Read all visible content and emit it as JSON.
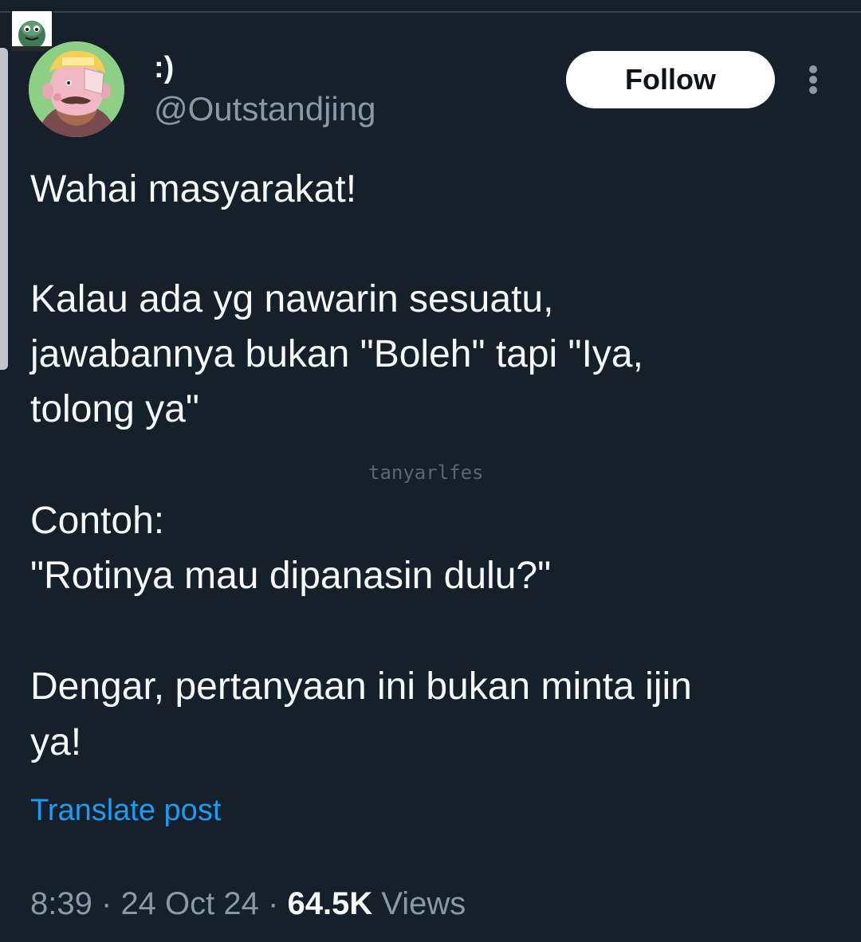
{
  "author": {
    "display_name": ":)",
    "handle": "@Outstandjing"
  },
  "actions": {
    "follow_label": "Follow",
    "more_icon": "more-vertical-icon"
  },
  "tweet": {
    "lines": [
      "Wahai masyarakat!",
      "Kalau ada yg nawarin sesuatu,",
      "jawabannya bukan \"Boleh\" tapi \"Iya,",
      "tolong ya\"",
      "Contoh:",
      "\"Rotinya mau dipanasin dulu?\"",
      "Dengar, pertanyaan ini bukan minta ijin",
      "ya!"
    ],
    "translate_label": "Translate post"
  },
  "watermark": "tanyarlfes",
  "meta": {
    "time": "8:39",
    "separator": "·",
    "date": "24 Oct 24",
    "views_count": "64.5K",
    "views_label": "Views"
  },
  "colors": {
    "background": "#15202b",
    "primary_text": "#f7f9f9",
    "secondary_text": "#8b98a5",
    "link": "#1d9bf0",
    "follow_button_bg": "#ffffff",
    "follow_button_text": "#0f1419"
  }
}
